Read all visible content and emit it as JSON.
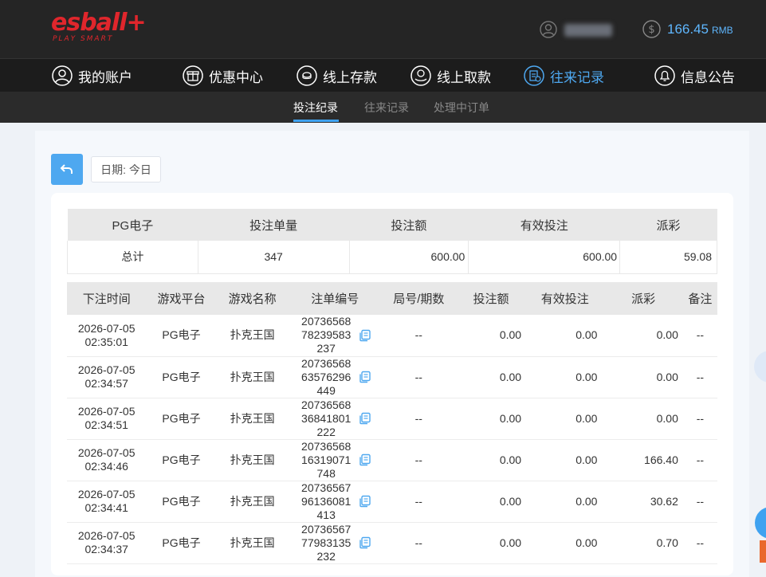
{
  "brand": {
    "logo": "esball+",
    "tagline": "PLAY SMART"
  },
  "header": {
    "balance": "166.45",
    "currency": "RMB"
  },
  "nav": [
    {
      "label": "我的账户",
      "icon": "user-circle-icon"
    },
    {
      "label": "优惠中心",
      "icon": "gift-icon"
    },
    {
      "label": "线上存款",
      "icon": "deposit-icon"
    },
    {
      "label": "线上取款",
      "icon": "withdraw-icon"
    },
    {
      "label": "往来记录",
      "icon": "records-icon",
      "active": true
    },
    {
      "label": "信息公告",
      "icon": "bell-icon"
    }
  ],
  "subnav": [
    {
      "label": "投注纪录",
      "active": true
    },
    {
      "label": "往来记录"
    },
    {
      "label": "处理中订单"
    }
  ],
  "filter": {
    "date_label": "日期: 今日"
  },
  "summary": {
    "headers": [
      "PG电子",
      "投注单量",
      "投注额",
      "有效投注",
      "派彩"
    ],
    "row": [
      "总计",
      "347",
      "600.00",
      "600.00",
      "59.08"
    ]
  },
  "detail": {
    "headers": [
      "下注时间",
      "游戏平台",
      "游戏名称",
      "注单编号",
      "局号/期数",
      "投注额",
      "有效投注",
      "派彩",
      "备注"
    ],
    "rows": [
      {
        "date": "2026-07-05",
        "time": "02:35:01",
        "platform": "PG电子",
        "game": "扑克王国",
        "order": "2073656878239583237",
        "round": "--",
        "bet": "0.00",
        "valid": "0.00",
        "payout": "0.00",
        "note": "--"
      },
      {
        "date": "2026-07-05",
        "time": "02:34:57",
        "platform": "PG电子",
        "game": "扑克王国",
        "order": "2073656863576296449",
        "round": "--",
        "bet": "0.00",
        "valid": "0.00",
        "payout": "0.00",
        "note": "--"
      },
      {
        "date": "2026-07-05",
        "time": "02:34:51",
        "platform": "PG电子",
        "game": "扑克王国",
        "order": "2073656836841801222",
        "round": "--",
        "bet": "0.00",
        "valid": "0.00",
        "payout": "0.00",
        "note": "--"
      },
      {
        "date": "2026-07-05",
        "time": "02:34:46",
        "platform": "PG电子",
        "game": "扑克王国",
        "order": "2073656816319071748",
        "round": "--",
        "bet": "0.00",
        "valid": "0.00",
        "payout": "166.40",
        "note": "--"
      },
      {
        "date": "2026-07-05",
        "time": "02:34:41",
        "platform": "PG电子",
        "game": "扑克王国",
        "order": "2073656796136081413",
        "round": "--",
        "bet": "0.00",
        "valid": "0.00",
        "payout": "30.62",
        "note": "--"
      },
      {
        "date": "2026-07-05",
        "time": "02:34:37",
        "platform": "PG电子",
        "game": "扑克王国",
        "order": "2073656777983135232",
        "round": "--",
        "bet": "0.00",
        "valid": "0.00",
        "payout": "0.70",
        "note": "--"
      }
    ]
  },
  "colors": {
    "accent": "#4ea8f0",
    "brand": "#e0262c",
    "header_bg": "#252525"
  }
}
